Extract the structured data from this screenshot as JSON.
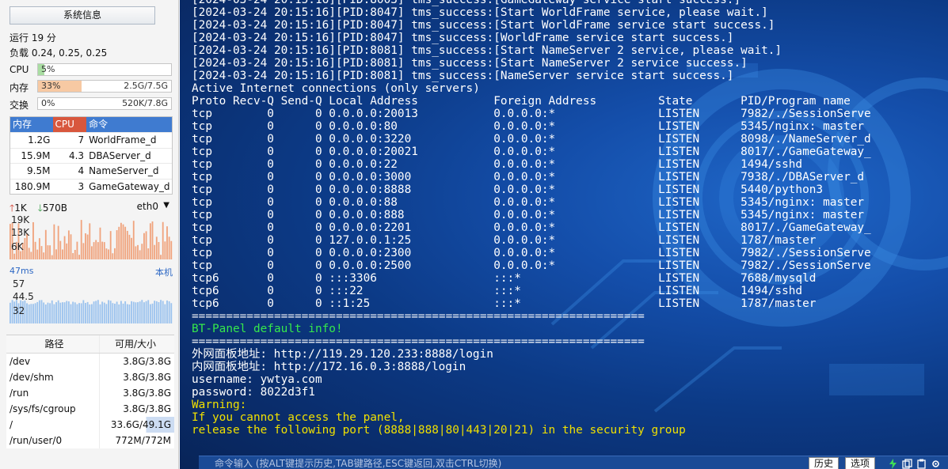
{
  "sidebar": {
    "sysinfo_button": "系统信息",
    "uptime": "运行 19 分",
    "load": "负载 0.24, 0.25, 0.25",
    "meters": [
      {
        "label": "CPU",
        "pct": "5%",
        "value": "",
        "fraction": 0.05,
        "color": "#a9dda2"
      },
      {
        "label": "内存",
        "pct": "33%",
        "value": "2.5G/7.5G",
        "fraction": 0.33,
        "color": "#f7c9a3"
      },
      {
        "label": "交换",
        "pct": "0%",
        "value": "520K/7.8G",
        "fraction": 0.0,
        "color": "#a9dda2"
      }
    ],
    "process_table": {
      "headers": {
        "mem": "内存",
        "cpu": "CPU",
        "name": "命令"
      },
      "rows": [
        {
          "mem": "1.2G",
          "cpu": "7",
          "name": "WorldFrame_d"
        },
        {
          "mem": "15.9M",
          "cpu": "4.3",
          "name": "DBAServer_d"
        },
        {
          "mem": "9.5M",
          "cpu": "4",
          "name": "NameServer_d"
        },
        {
          "mem": "180.9M",
          "cpu": "3",
          "name": "GameGateway_d"
        }
      ]
    },
    "network": {
      "up": "1K",
      "down": "570B",
      "interface": "eth0",
      "y_ticks": [
        "19K",
        "13K",
        "6K"
      ]
    },
    "latency": {
      "value": "47ms",
      "host": "本机",
      "y_ticks": [
        "57",
        "44.5",
        "32"
      ]
    },
    "disk_table": {
      "headers": {
        "path": "路径",
        "size": "可用/大小"
      },
      "rows": [
        {
          "path": "/dev",
          "size": "3.8G/3.8G"
        },
        {
          "path": "/dev/shm",
          "size": "3.8G/3.8G"
        },
        {
          "path": "/run",
          "size": "3.8G/3.8G"
        },
        {
          "path": "/sys/fs/cgroup",
          "size": "3.8G/3.8G"
        },
        {
          "path": "/",
          "size": "33.6G/49.1G"
        },
        {
          "path": "/run/user/0",
          "size": "772M/772M"
        }
      ]
    }
  },
  "terminal": {
    "lines": [
      {
        "t": "[2024-03-24 20:15:16][PID:8003] tms_success:[GameGateway service start success.]",
        "c": ""
      },
      {
        "t": "[2024-03-24 20:15:16][PID:8047] tms_success:[Start WorldFrame service, please wait.]",
        "c": ""
      },
      {
        "t": "[2024-03-24 20:15:16][PID:8047] tms_success:[Start WorldFrame service start success.]",
        "c": ""
      },
      {
        "t": "[2024-03-24 20:15:16][PID:8047] tms_success:[WorldFrame service start success.]",
        "c": ""
      },
      {
        "t": "[2024-03-24 20:15:16][PID:8081] tms_success:[Start NameServer 2 service, please wait.]",
        "c": ""
      },
      {
        "t": "[2024-03-24 20:15:16][PID:8081] tms_success:[Start NameServer 2 service success.]",
        "c": ""
      },
      {
        "t": "[2024-03-24 20:15:16][PID:8081] tms_success:[NameServer service start success.]",
        "c": ""
      },
      {
        "t": "Active Internet connections (only servers)",
        "c": ""
      },
      {
        "t": "Proto Recv-Q Send-Q Local Address           Foreign Address         State       PID/Program name",
        "c": ""
      },
      {
        "t": "tcp        0      0 0.0.0.0:20013           0.0.0.0:*               LISTEN      7982/./SessionServe",
        "c": ""
      },
      {
        "t": "tcp        0      0 0.0.0.0:80              0.0.0.0:*               LISTEN      5345/nginx: master",
        "c": ""
      },
      {
        "t": "tcp        0      0 0.0.0.0:3220            0.0.0.0:*               LISTEN      8098/./NameServer_d",
        "c": ""
      },
      {
        "t": "tcp        0      0 0.0.0.0:20021           0.0.0.0:*               LISTEN      8017/./GameGateway_",
        "c": ""
      },
      {
        "t": "tcp        0      0 0.0.0.0:22              0.0.0.0:*               LISTEN      1494/sshd",
        "c": ""
      },
      {
        "t": "tcp        0      0 0.0.0.0:3000            0.0.0.0:*               LISTEN      7938/./DBAServer_d",
        "c": ""
      },
      {
        "t": "tcp        0      0 0.0.0.0:8888            0.0.0.0:*               LISTEN      5440/python3",
        "c": ""
      },
      {
        "t": "tcp        0      0 0.0.0.0:88              0.0.0.0:*               LISTEN      5345/nginx: master",
        "c": ""
      },
      {
        "t": "tcp        0      0 0.0.0.0:888             0.0.0.0:*               LISTEN      5345/nginx: master",
        "c": ""
      },
      {
        "t": "tcp        0      0 0.0.0.0:2201            0.0.0.0:*               LISTEN      8017/./GameGateway_",
        "c": ""
      },
      {
        "t": "tcp        0      0 127.0.0.1:25            0.0.0.0:*               LISTEN      1787/master",
        "c": ""
      },
      {
        "t": "tcp        0      0 0.0.0.0:2300            0.0.0.0:*               LISTEN      7982/./SessionServe",
        "c": ""
      },
      {
        "t": "tcp        0      0 0.0.0.0:2500            0.0.0.0:*               LISTEN      7982/./SessionServe",
        "c": ""
      },
      {
        "t": "tcp6       0      0 :::3306                 :::*                    LISTEN      7688/mysqld",
        "c": ""
      },
      {
        "t": "tcp6       0      0 :::22                   :::*                    LISTEN      1494/sshd",
        "c": ""
      },
      {
        "t": "tcp6       0      0 ::1:25                  :::*                    LISTEN      1787/master",
        "c": ""
      },
      {
        "t": "==================================================================",
        "c": "sep"
      },
      {
        "t": "BT-Panel default info!",
        "c": "g"
      },
      {
        "t": "==================================================================",
        "c": "sep"
      },
      {
        "t": "外网面板地址: http://119.29.120.233:8888/login",
        "c": ""
      },
      {
        "t": "内网面板地址: http://172.16.0.3:8888/login",
        "c": ""
      },
      {
        "t": "username: ywtya.com",
        "c": ""
      },
      {
        "t": "password: 8022d3f1",
        "c": ""
      },
      {
        "t": "Warning:",
        "c": "y"
      },
      {
        "t": "If you cannot access the panel,",
        "c": "y"
      },
      {
        "t": "release the following port (8888|888|80|443|20|21) in the security group",
        "c": "y"
      }
    ]
  },
  "command_bar": {
    "placeholder": "命令输入 (按ALT键提示历史,TAB键路径,ESC键返回,双击CTRL切换)",
    "history_button": "历史",
    "options_button": "选项"
  },
  "colors": {
    "cpu_header": "#d8573d",
    "header_blue": "#3f7bd0",
    "net_bars": "#f0a47e",
    "latency_bars": "#9cc3ee",
    "warning_yellow": "#f0e000",
    "info_green": "#35e84b"
  }
}
